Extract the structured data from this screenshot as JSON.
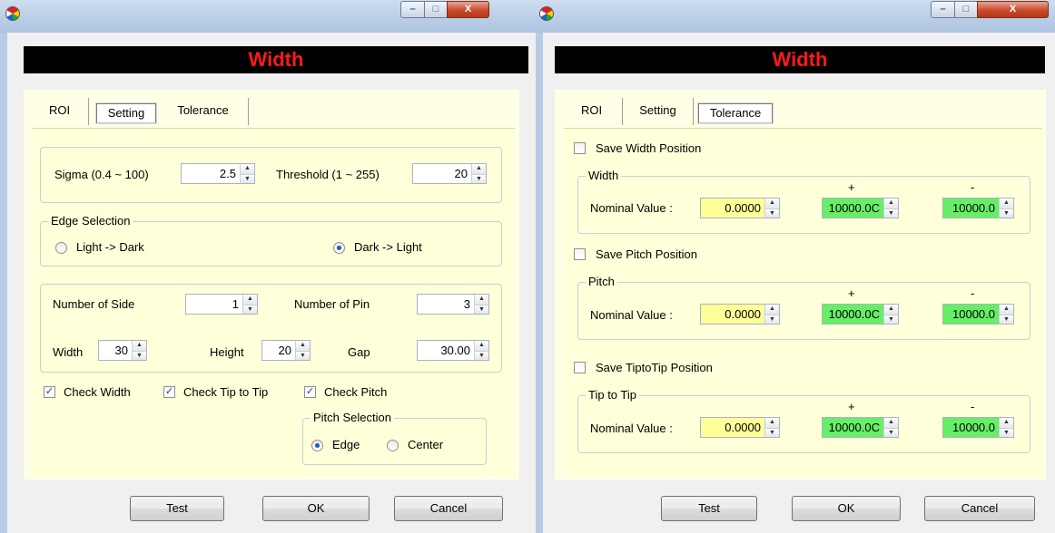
{
  "left": {
    "banner_title": "Width",
    "tabs": [
      "ROI",
      "Setting",
      "Tolerance"
    ],
    "sigma_label": "Sigma (0.4 ~ 100)",
    "sigma_value": "2.5",
    "threshold_label": "Threshold (1 ~ 255)",
    "threshold_value": "20",
    "edge_group_title": "Edge Selection",
    "edge_option_1": "Light -> Dark",
    "edge_option_2": "Dark -> Light",
    "num_side_label": "Number of Side",
    "num_side_value": "1",
    "num_pin_label": "Number of Pin",
    "num_pin_value": "3",
    "width_label": "Width",
    "width_value": "30",
    "height_label": "Height",
    "height_value": "20",
    "gap_label": "Gap",
    "gap_value": "30.00",
    "check_width": "Check Width",
    "check_tip": "Check Tip to Tip",
    "check_pitch": "Check Pitch",
    "pitch_group_title": "Pitch Selection",
    "pitch_edge": "Edge",
    "pitch_center": "Center",
    "buttons": {
      "test": "Test",
      "ok": "OK",
      "cancel": "Cancel"
    }
  },
  "right": {
    "banner_title": "Width",
    "tabs": [
      "ROI",
      "Setting",
      "Tolerance"
    ],
    "sections": [
      {
        "save_label": "Save Width Position",
        "group_title": "Width",
        "nominal_label": "Nominal Value :",
        "nominal_value": "0.0000",
        "plus_label": "+",
        "plus_value": "10000.0C",
        "minus_label": "-",
        "minus_value": "10000.0"
      },
      {
        "save_label": "Save Pitch Position",
        "group_title": "Pitch",
        "nominal_label": "Nominal Value :",
        "nominal_value": "0.0000",
        "plus_label": "+",
        "plus_value": "10000.0C",
        "minus_label": "-",
        "minus_value": "10000.0"
      },
      {
        "save_label": "Save TiptoTip Position",
        "group_title": "Tip to Tip",
        "nominal_label": "Nominal Value :",
        "nominal_value": "0.0000",
        "plus_label": "+",
        "plus_value": "10000.0C",
        "minus_label": "-",
        "minus_value": "10000.0"
      }
    ],
    "buttons": {
      "test": "Test",
      "ok": "OK",
      "cancel": "Cancel"
    }
  },
  "window_buttons": {
    "minimize": "–",
    "maximize": "□",
    "close": "X"
  },
  "icons": {
    "app": "app-icon",
    "check": "✓",
    "spin_up": "▲",
    "spin_down": "▼"
  }
}
